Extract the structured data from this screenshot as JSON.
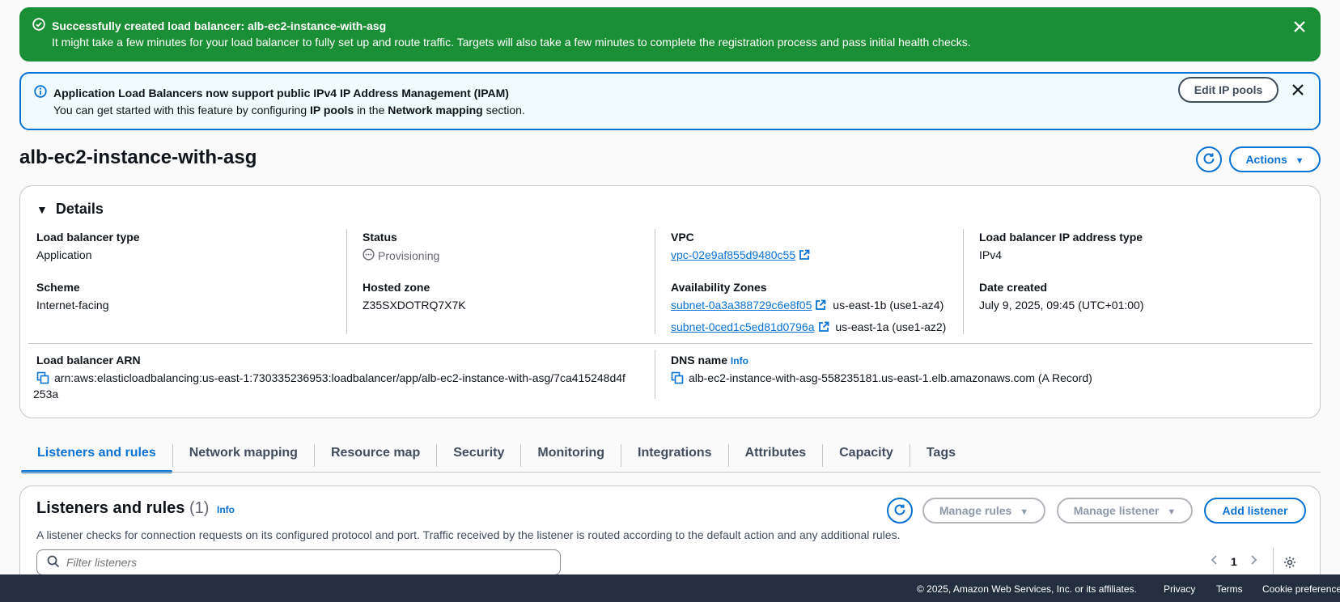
{
  "success_flash": {
    "title": "Successfully created load balancer: alb-ec2-instance-with-asg",
    "message": "It might take a few minutes for your load balancer to fully set up and route traffic. Targets will also take a few minutes to complete the registration process and pass initial health checks."
  },
  "info_flash": {
    "title": "Application Load Balancers now support public IPv4 IP Address Management (IPAM)",
    "message_pre": "You can get started with this feature by configuring ",
    "message_b1": "IP pools",
    "message_mid": " in the ",
    "message_b2": "Network mapping",
    "message_post": " section.",
    "button": "Edit IP pools"
  },
  "page": {
    "title": "alb-ec2-instance-with-asg",
    "actions_label": "Actions"
  },
  "details": {
    "header": "Details",
    "lb_type_label": "Load balancer type",
    "lb_type_value": "Application",
    "scheme_label": "Scheme",
    "scheme_value": "Internet-facing",
    "status_label": "Status",
    "status_value": "Provisioning",
    "hosted_zone_label": "Hosted zone",
    "hosted_zone_value": "Z35SXDOTRQ7X7K",
    "vpc_label": "VPC",
    "vpc_value": "vpc-02e9af855d9480c55",
    "az_label": "Availability Zones",
    "az1_subnet": "subnet-0a3a388729c6e8f05",
    "az1_zone": "us-east-1b (use1-az4)",
    "az2_subnet": "subnet-0ced1c5ed81d0796a",
    "az2_zone": "us-east-1a (use1-az2)",
    "ip_type_label": "Load balancer IP address type",
    "ip_type_value": "IPv4",
    "date_label": "Date created",
    "date_value": "July 9, 2025, 09:45 (UTC+01:00)",
    "arn_label": "Load balancer ARN",
    "arn_value_line1": "arn:aws:elasticloadbalancing:us-east-1:730335236953:loadbalancer/app/alb-ec2-instance-with-asg/7ca415248d4f",
    "arn_value_line2": "253a",
    "dns_label": "DNS name",
    "dns_info": "Info",
    "dns_value": "alb-ec2-instance-with-asg-558235181.us-east-1.elb.amazonaws.com (A Record)"
  },
  "tabs": [
    {
      "label": "Listeners and rules"
    },
    {
      "label": "Network mapping"
    },
    {
      "label": "Resource map"
    },
    {
      "label": "Security"
    },
    {
      "label": "Monitoring"
    },
    {
      "label": "Integrations"
    },
    {
      "label": "Attributes"
    },
    {
      "label": "Capacity"
    },
    {
      "label": "Tags"
    }
  ],
  "listeners": {
    "title": "Listeners and rules",
    "count": "(1)",
    "info": "Info",
    "description": "A listener checks for connection requests on its configured protocol and port. Traffic received by the listener is routed according to the default action and any additional rules.",
    "manage_rules": "Manage rules",
    "manage_listener": "Manage listener",
    "add_listener": "Add listener",
    "filter_placeholder": "Filter listeners",
    "page_number": "1"
  },
  "footer": {
    "copyright": "© 2025, Amazon Web Services, Inc. or its affiliates.",
    "privacy": "Privacy",
    "terms": "Terms",
    "cookies": "Cookie preferences"
  },
  "colors": {
    "success": "#1b8f35",
    "info_bg": "#f0fbff",
    "accent": "#0972d3",
    "footer_bg": "#232f3e"
  }
}
